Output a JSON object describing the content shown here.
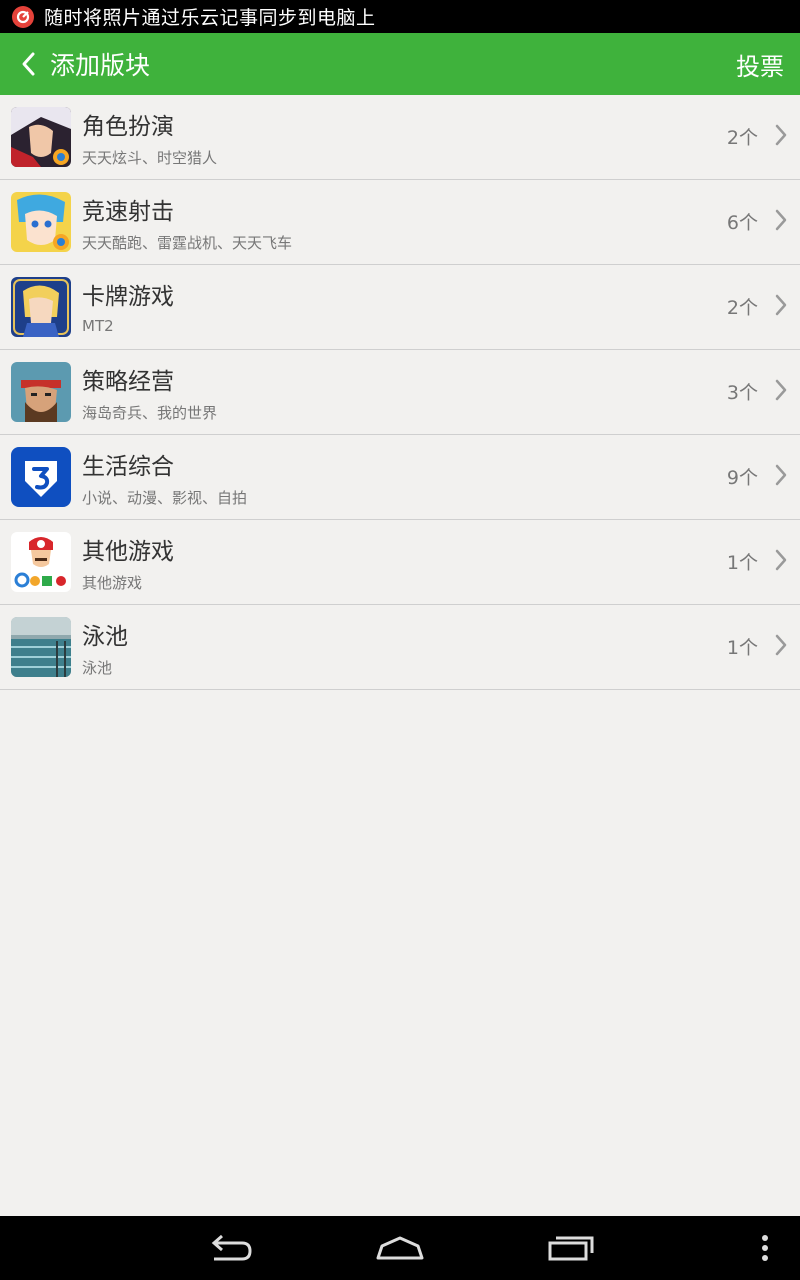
{
  "status_bar": {
    "notification_text": "随时将照片通过乐云记事同步到电脑上",
    "icon": "letv-cloud-icon"
  },
  "action_bar": {
    "title": "添加版块",
    "back_icon": "chevron-left-icon",
    "right_action": "投票",
    "background": "#3fb23c"
  },
  "categories": [
    {
      "title": "角色扮演",
      "subtitle": "天天炫斗、时空猎人",
      "count": "2个",
      "icon": "role-play-game-icon"
    },
    {
      "title": "竞速射击",
      "subtitle": "天天酷跑、雷霆战机、天天飞车",
      "count": "6个",
      "icon": "racing-shooting-game-icon"
    },
    {
      "title": "卡牌游戏",
      "subtitle": "MT2",
      "count": "2个",
      "icon": "card-game-icon"
    },
    {
      "title": "策略经营",
      "subtitle": "海岛奇兵、我的世界",
      "count": "3个",
      "icon": "strategy-game-icon"
    },
    {
      "title": "生活综合",
      "subtitle": "小说、动漫、影视、自拍",
      "count": "9个",
      "icon": "lifestyle-app-icon"
    },
    {
      "title": "其他游戏",
      "subtitle": "其他游戏",
      "count": "1个",
      "icon": "other-games-icon"
    },
    {
      "title": "泳池",
      "subtitle": "泳池",
      "count": "1个",
      "icon": "swimming-pool-icon"
    }
  ],
  "nav_bar": {
    "buttons": [
      "back-icon",
      "home-icon",
      "recent-apps-icon",
      "overflow-menu-icon"
    ]
  }
}
